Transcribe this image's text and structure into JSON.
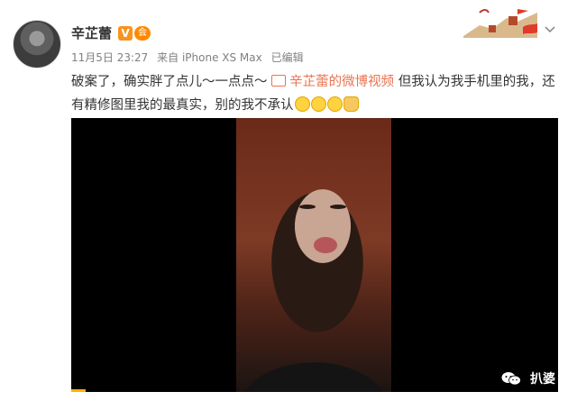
{
  "post": {
    "author": "辛芷蕾",
    "verified_badge": "V",
    "vip_badge": "会",
    "timestamp": "11月5日 23:27",
    "source": "来自 iPhone XS Max",
    "edited": "已编辑",
    "text_part1": "破案了，确实胖了点儿～一点点～",
    "video_link": "辛芷蕾的微博视频",
    "text_part2": "但我认为我手机里的我，还有精修图里我的最真实，别的我不承认"
  },
  "icons": {
    "avatar": "avatar-photo",
    "more": "chevron-down-icon",
    "banner": "great-wall-flag-banner",
    "video_link": "video-camera-icon",
    "emojis": [
      "doge-face-emoji",
      "laughing-tears-emoji",
      "smile-emoji",
      "thumbs-up-emoji"
    ]
  },
  "video": {
    "progress_fraction": 0.03
  },
  "watermark": {
    "text": "扒婆"
  },
  "colors": {
    "link": "#eb7350",
    "meta": "#808080",
    "badge": "#f7941d"
  }
}
